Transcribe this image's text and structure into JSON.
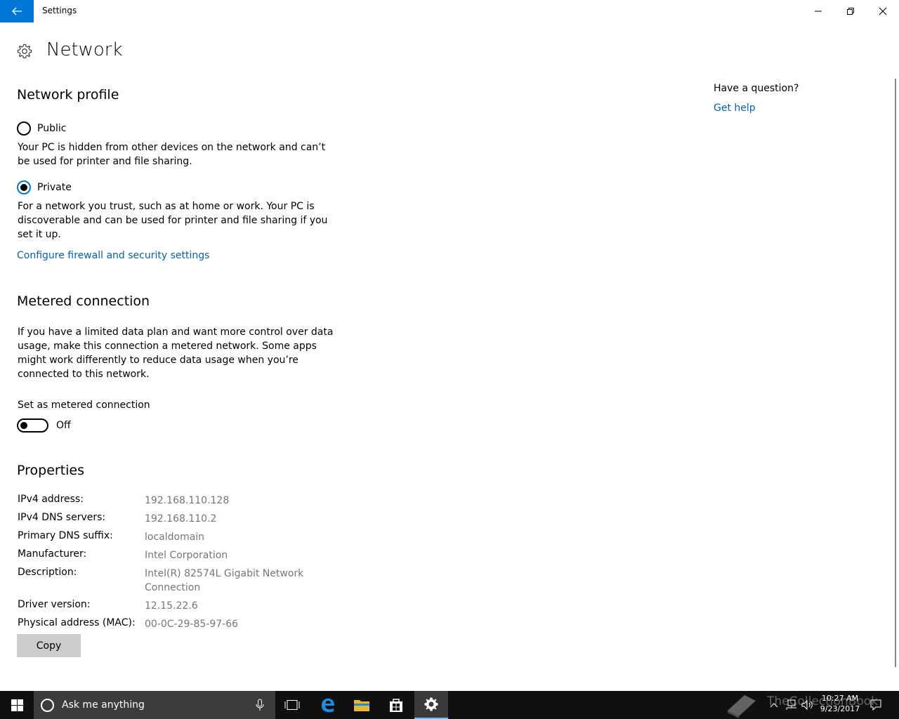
{
  "window": {
    "title": "Settings",
    "minimize_icon": "minimize-icon",
    "maximize_icon": "restore-icon",
    "close_icon": "close-icon"
  },
  "page": {
    "title": "Network",
    "icon": "gear-icon"
  },
  "network_profile": {
    "heading": "Network profile",
    "options": [
      {
        "label": "Public",
        "selected": false,
        "description": "Your PC is hidden from other devices on the network and can’t be used for printer and file sharing."
      },
      {
        "label": "Private",
        "selected": true,
        "description": "For a network you trust, such as at home or work. Your PC is discoverable and can be used for printer and file sharing if you set it up."
      }
    ],
    "firewall_link": "Configure firewall and security settings"
  },
  "metered": {
    "heading": "Metered connection",
    "description": "If you have a limited data plan and want more control over data usage, make this connection a metered network. Some apps might work differently to reduce data usage when you’re connected to this network.",
    "toggle_label": "Set as metered connection",
    "toggle_state": "Off"
  },
  "properties": {
    "heading": "Properties",
    "rows": [
      {
        "label": "IPv4 address:",
        "value": "192.168.110.128"
      },
      {
        "label": "IPv4 DNS servers:",
        "value": "192.168.110.2"
      },
      {
        "label": "Primary DNS suffix:",
        "value": "localdomain"
      },
      {
        "label": "Manufacturer:",
        "value": "Intel Corporation"
      },
      {
        "label": "Description:",
        "value": "Intel(R) 82574L Gigabit Network Connection"
      },
      {
        "label": "Driver version:",
        "value": "12.15.22.6"
      },
      {
        "label": "Physical address (MAC):",
        "value": "00-0C-29-85-97-66"
      }
    ],
    "copy_label": "Copy"
  },
  "help": {
    "question": "Have a question?",
    "link": "Get help"
  },
  "taskbar": {
    "search_placeholder": "Ask me anything",
    "time": "10:27 AM",
    "date": "9/23/2017",
    "watermark": "TheCollectionBook"
  },
  "colors": {
    "accent": "#0078d7",
    "link": "#0063b1",
    "taskbar": "#101010"
  }
}
